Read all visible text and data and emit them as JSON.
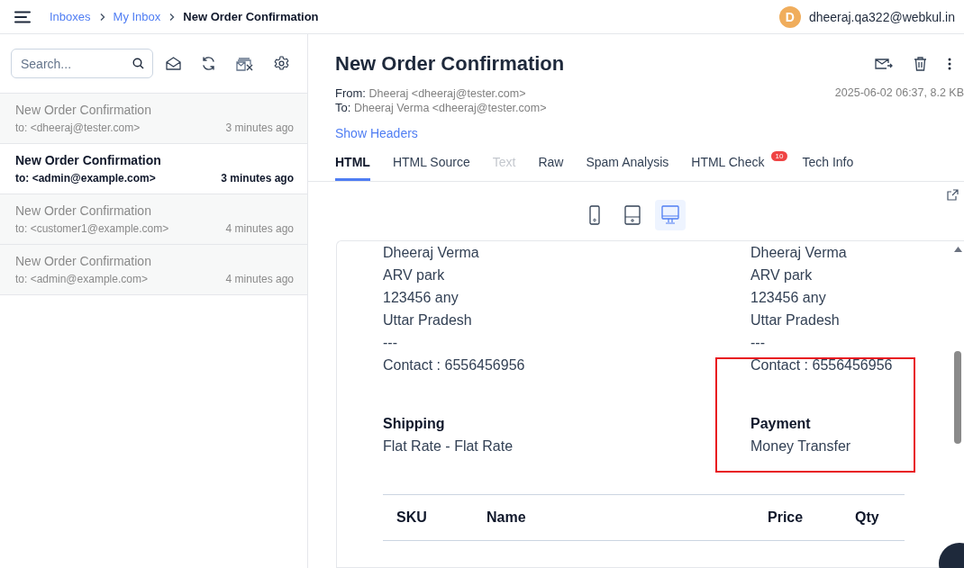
{
  "breadcrumbs": [
    {
      "label": "Inboxes",
      "kind": "link"
    },
    {
      "label": "My Inbox",
      "kind": "link"
    },
    {
      "label": "New Order Confirmation",
      "kind": "current"
    }
  ],
  "user": {
    "initial": "D",
    "email": "dheeraj.qa322@webkul.in"
  },
  "search": {
    "placeholder": "Search..."
  },
  "messages": [
    {
      "subject": "New Order Confirmation",
      "to": "to: <dheeraj@tester.com>",
      "time": "3 minutes ago",
      "selected": false
    },
    {
      "subject": "New Order Confirmation",
      "to": "to: <admin@example.com>",
      "time": "3 minutes ago",
      "selected": true
    },
    {
      "subject": "New Order Confirmation",
      "to": "to: <customer1@example.com>",
      "time": "4 minutes ago",
      "selected": false
    },
    {
      "subject": "New Order Confirmation",
      "to": "to: <admin@example.com>",
      "time": "4 minutes ago",
      "selected": false
    }
  ],
  "message": {
    "title": "New Order Confirmation",
    "from_label": "From:",
    "from": "Dheeraj <dheeraj@tester.com>",
    "to_label": "To:",
    "to": "Dheeraj Verma <dheeraj@tester.com>",
    "meta": "2025-06-02 06:37, 8.2 KB",
    "show_headers": "Show Headers"
  },
  "tabs": [
    {
      "label": "HTML",
      "selected": true,
      "disabled": false
    },
    {
      "label": "HTML Source",
      "selected": false,
      "disabled": false
    },
    {
      "label": "Text",
      "selected": false,
      "disabled": true
    },
    {
      "label": "Raw",
      "selected": false,
      "disabled": false
    },
    {
      "label": "Spam Analysis",
      "selected": false,
      "disabled": false
    },
    {
      "label": "HTML Check",
      "selected": false,
      "disabled": false,
      "badge": "10"
    },
    {
      "label": "Tech Info",
      "selected": false,
      "disabled": false
    }
  ],
  "devices": [
    {
      "kind": "phone",
      "selected": false
    },
    {
      "kind": "tablet",
      "selected": false
    },
    {
      "kind": "desktop",
      "selected": true
    }
  ],
  "email": {
    "addresses": [
      [
        "Dheeraj Verma",
        "ARV park",
        "123456 any",
        "Uttar Pradesh",
        "---",
        "Contact : 6556456956"
      ],
      [
        "Dheeraj Verma",
        "ARV park",
        "123456 any",
        "Uttar Pradesh",
        "---",
        "Contact : 6556456956"
      ]
    ],
    "sections": [
      {
        "heading": "Shipping",
        "value": "Flat Rate - Flat Rate",
        "highlighted": false
      },
      {
        "heading": "Payment",
        "value": "Money Transfer",
        "highlighted": true
      }
    ],
    "columns": [
      "SKU",
      "Name",
      "Price",
      "Qty"
    ]
  }
}
